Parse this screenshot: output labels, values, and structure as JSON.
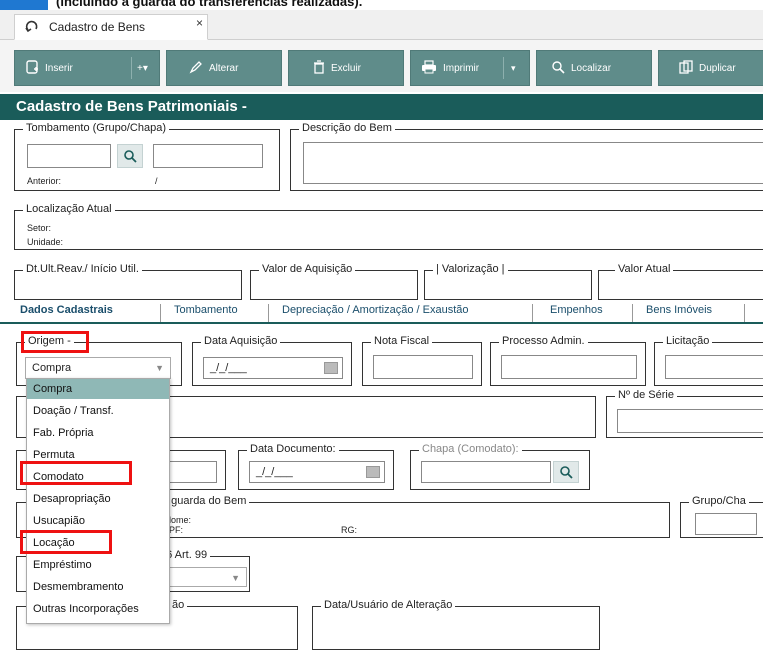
{
  "top_note": "(incluindo a guarda do transferências realizadas).",
  "window_tab": {
    "label": "Cadastro de Bens",
    "close": "×"
  },
  "toolbar": {
    "inserir": "Inserir",
    "alterar": "Alterar",
    "excluir": "Excluir",
    "imprimir": "Imprimir",
    "localizar": "Localizar",
    "duplicar": "Duplicar"
  },
  "header_title": "Cadastro de Bens Patrimoniais -",
  "tombamento": {
    "legend": "Tombamento (Grupo/Chapa)",
    "anterior_label": "Anterior:",
    "anterior_value": "/"
  },
  "descricao": {
    "legend": "Descrição do Bem"
  },
  "localizacao": {
    "legend": "Localização Atual",
    "setor": "Setor:",
    "unidade": "Unidade:"
  },
  "valores": {
    "dt_ult": "Dt.Ult.Reav./ Início Util.",
    "valor_aquisicao": "Valor de Aquisição",
    "valorizacao": "| Valorização |",
    "valor_atual": "Valor Atual"
  },
  "tabs": [
    "Dados Cadastrais",
    "Tombamento",
    "Depreciação / Amortização / Exaustão",
    "Empenhos",
    "Bens Imóveis"
  ],
  "form": {
    "origem_legend": "Origem -",
    "origem_value": "Compra",
    "data_aquisicao": "Data Aquisição",
    "date_placeholder": "_/_/___",
    "nota_fiscal": "Nota Fiscal",
    "processo_admin": "Processo Admin.",
    "licitacao": "Licitação",
    "num_serie": "Nº de Série",
    "data_documento": "Data Documento:",
    "chapa_comodato": "Chapa (Comodato):",
    "guarda_legend": "a guarda do Bem",
    "nome_label": "lome:",
    "cpf_label": "PF:",
    "rg_label": "RG:",
    "grupo_cha": "Grupo/Cha",
    "lei_label": "06 Art. 99",
    "inclusao_legend": "ão",
    "data_usuario_alteracao": "Data/Usuário de Alteração"
  },
  "dropdown_options": [
    "Compra",
    "Doação / Transf.",
    "Fab. Própria",
    "Permuta",
    "Comodato",
    "Desapropriação",
    "Usucapião",
    "Locação",
    "Empréstimo",
    "Desmembramento",
    "Outras Incorporações"
  ],
  "colors": {
    "header_bg": "#1a5c5a",
    "button_bg": "#5f8c8a",
    "highlight_red": "#e11111",
    "selected_option": "#8fb8b6"
  }
}
